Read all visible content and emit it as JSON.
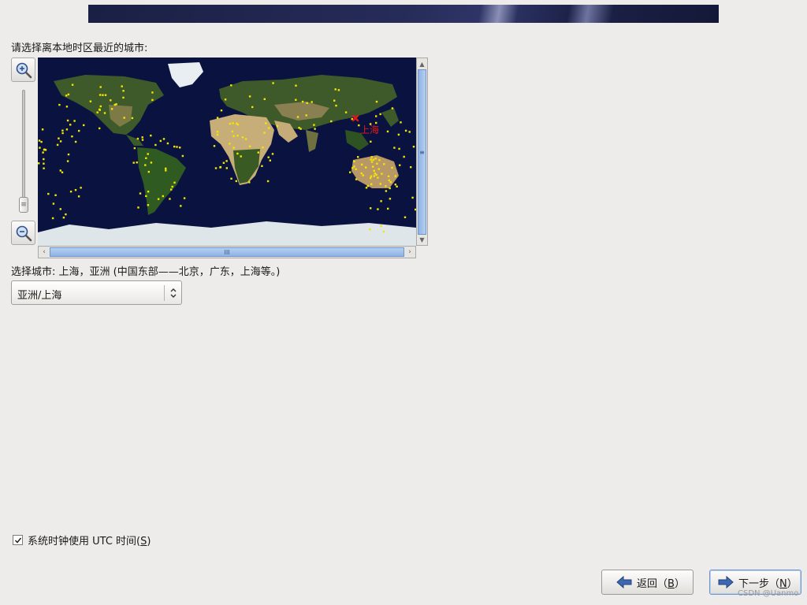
{
  "header": {
    "banner": ""
  },
  "timezone": {
    "prompt": "请选择离本地时区最近的城市:",
    "map_marker_label": "上海",
    "selected_city_label": "选择城市: 上海，亚洲 (中国东部——北京，广东，上海等。)",
    "combo_value": "亚洲/上海"
  },
  "utc": {
    "checked": true,
    "label_prefix": "系统时钟使用 UTC 时间(",
    "mnemonic": "S",
    "label_suffix": ")"
  },
  "buttons": {
    "back": {
      "label_prefix": "返回（",
      "mnemonic": "B",
      "label_suffix": "）"
    },
    "next": {
      "label_prefix": "下一步（",
      "mnemonic": "N",
      "label_suffix": "）"
    }
  },
  "watermark": "CSDN @Uanmo",
  "icons": {
    "zoom_in": "zoom-in-icon",
    "zoom_out": "zoom-out-icon",
    "back": "arrow-left-icon",
    "next": "arrow-right-icon",
    "combo": "chevron-updown-icon",
    "check": "checkmark-icon"
  },
  "colors": {
    "marker": "#e01818",
    "city_dot": "#f2e600",
    "ocean": "#0a1340",
    "accent": "#6f95cc"
  }
}
